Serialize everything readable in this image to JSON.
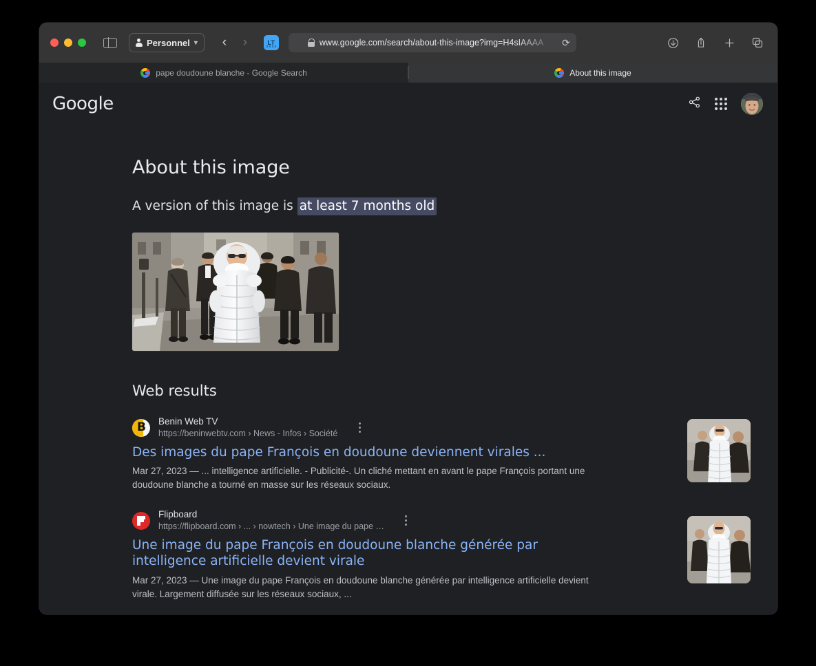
{
  "browser": {
    "profile_label": "Personnel",
    "profile_icon": "person-icon",
    "sidebar_icon": "sidebar-toggle-icon",
    "back_icon": "chevron-left-icon",
    "forward_icon": "chevron-right-icon",
    "extension_label": "LT",
    "lock_icon": "lock-icon",
    "url": "www.google.com/search/about-this-image?img=H4sIAAAA",
    "reload_icon": "reload-icon",
    "right_buttons": [
      {
        "name": "downloads-icon",
        "glyph": "↓"
      },
      {
        "name": "share-icon",
        "glyph": "↑"
      },
      {
        "name": "new-tab-icon",
        "glyph": "+"
      },
      {
        "name": "tab-overview-icon",
        "glyph": "⧉"
      }
    ],
    "tabs": [
      {
        "label": "pape doudoune blanche - Google Search",
        "active": false
      },
      {
        "label": "About this image",
        "active": true
      }
    ]
  },
  "google_header": {
    "logo": "Google",
    "share_icon": "share-icon",
    "apps_icon": "apps-grid-icon",
    "avatar_icon": "user-avatar"
  },
  "main": {
    "title": "About this image",
    "verdict_prefix": "A version of this image is ",
    "verdict_highlight": "at least 7 months old",
    "hero_image_alt": "pope-in-white-puffer-jacket-image",
    "web_results_heading": "Web results"
  },
  "results": [
    {
      "site_name": "Benin Web TV",
      "site_url": "https://beninwebtv.com › News - Infos › Société",
      "title": "Des images du pape François en doudoune deviennent virales ...",
      "snippet": "Mar 27, 2023 — ... intelligence artificielle. - Publicité-. Un cliché mettant en avant le pape François portant une doudoune blanche a tourné en masse sur les réseaux sociaux.",
      "favicon": "beninwebtv-favicon",
      "thumb": "pope-puffer-thumbnail"
    },
    {
      "site_name": "Flipboard",
      "site_url": "https://flipboard.com › ... › nowtech › Une image du pape …",
      "title": "Une image du pape François en doudoune blanche générée par intelligence artificielle devient virale",
      "snippet": "Mar 27, 2023 — Une image du pape François en doudoune blanche générée par intelligence artificielle devient virale. Largement diffusée sur les réseaux sociaux, ...",
      "favicon": "flipboard-favicon",
      "thumb": "pope-puffer-thumbnail"
    }
  ],
  "colors": {
    "page_bg": "#1f2023",
    "chrome_bg": "#353535",
    "link": "#8ab4f8",
    "highlight": "#464b63",
    "text": "#e8eaed",
    "muted": "#9aa0a6"
  }
}
